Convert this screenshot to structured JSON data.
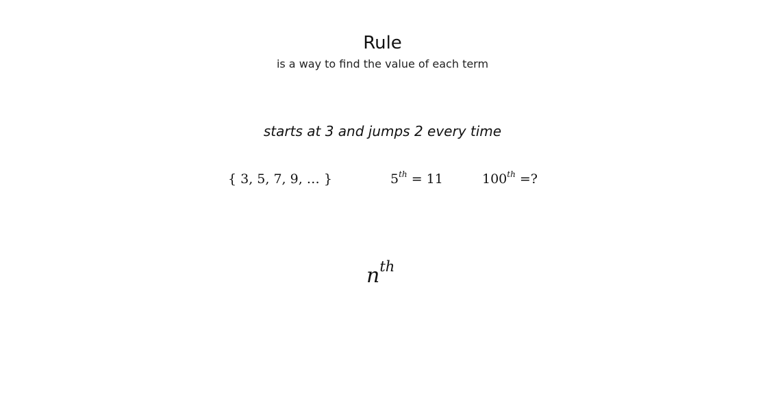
{
  "slide": {
    "title": "Rule",
    "subtitle": "is a way to find the value of each term",
    "description": "starts at 3 and jumps 2 every time"
  },
  "math": {
    "sequence": "{ 3, 5, 7, 9, … }",
    "fifth_base": "5",
    "fifth_sup": "th",
    "fifth_rest": " = 11",
    "hundredth_base": "100",
    "hundredth_sup": "th",
    "hundredth_rest": " =?",
    "nth_base": "n",
    "nth_sup": "th"
  }
}
